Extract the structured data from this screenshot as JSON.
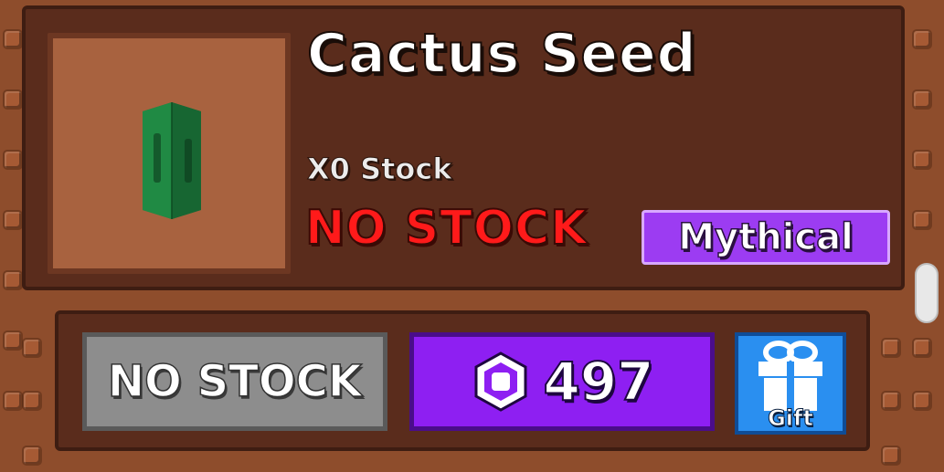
{
  "item": {
    "name": "Cactus Seed",
    "stock_count_label": "X0 Stock",
    "stock_status": "NO STOCK",
    "rarity": "Mythical",
    "icon": "cactus-seed-pack-icon"
  },
  "actions": {
    "no_stock_label": "NO STOCK",
    "price": "497",
    "currency_icon": "robux-icon",
    "gift_label": "Gift",
    "gift_icon": "gift-icon"
  },
  "colors": {
    "panel": "#5a2c1c",
    "frame": "#8e4d2c",
    "no_stock_text": "#ff1a1a",
    "rarity_badge": "#9c3cf2",
    "price_button": "#8e1ff2",
    "disabled_button": "#8d8d8d",
    "gift_button": "#2a8ff0"
  }
}
